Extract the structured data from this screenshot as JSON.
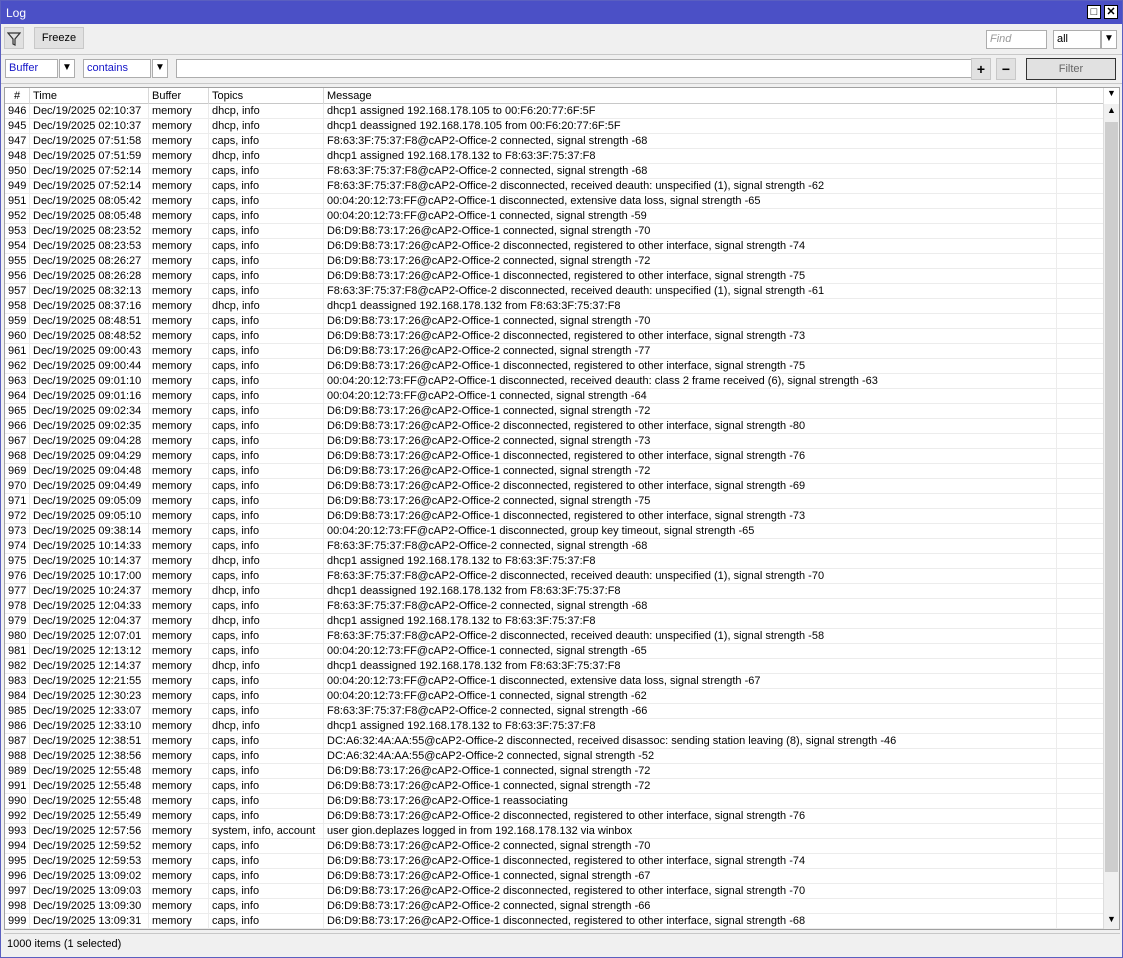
{
  "window": {
    "title": "Log",
    "maximize_icon": "maximize-icon",
    "close_icon": "close-icon"
  },
  "toolbar": {
    "filter_icon": "funnel-icon",
    "freeze_label": "Freeze",
    "find_placeholder": "Find",
    "find_scope": "all"
  },
  "filter": {
    "field": "Buffer",
    "operator": "contains",
    "value": "",
    "add_label": "+",
    "remove_label": "−",
    "filter_label": "Filter"
  },
  "table": {
    "columns": [
      "#",
      "Time",
      "Buffer",
      "Topics",
      "Message"
    ],
    "rows": [
      [
        "946",
        "Dec/19/2025 02:10:37",
        "memory",
        "dhcp, info",
        "dhcp1 assigned 192.168.178.105 to 00:F6:20:77:6F:5F"
      ],
      [
        "945",
        "Dec/19/2025 02:10:37",
        "memory",
        "dhcp, info",
        "dhcp1 deassigned 192.168.178.105 from 00:F6:20:77:6F:5F"
      ],
      [
        "947",
        "Dec/19/2025 07:51:58",
        "memory",
        "caps, info",
        "F8:63:3F:75:37:F8@cAP2-Office-2 connected, signal strength -68"
      ],
      [
        "948",
        "Dec/19/2025 07:51:59",
        "memory",
        "dhcp, info",
        "dhcp1 assigned 192.168.178.132 to F8:63:3F:75:37:F8"
      ],
      [
        "950",
        "Dec/19/2025 07:52:14",
        "memory",
        "caps, info",
        "F8:63:3F:75:37:F8@cAP2-Office-2 connected, signal strength -68"
      ],
      [
        "949",
        "Dec/19/2025 07:52:14",
        "memory",
        "caps, info",
        "F8:63:3F:75:37:F8@cAP2-Office-2 disconnected, received deauth: unspecified (1), signal strength -62"
      ],
      [
        "951",
        "Dec/19/2025 08:05:42",
        "memory",
        "caps, info",
        "00:04:20:12:73:FF@cAP2-Office-1 disconnected, extensive data loss, signal strength -65"
      ],
      [
        "952",
        "Dec/19/2025 08:05:48",
        "memory",
        "caps, info",
        "00:04:20:12:73:FF@cAP2-Office-1 connected, signal strength -59"
      ],
      [
        "953",
        "Dec/19/2025 08:23:52",
        "memory",
        "caps, info",
        "D6:D9:B8:73:17:26@cAP2-Office-1 connected, signal strength -70"
      ],
      [
        "954",
        "Dec/19/2025 08:23:53",
        "memory",
        "caps, info",
        "D6:D9:B8:73:17:26@cAP2-Office-2 disconnected, registered to other interface, signal strength -74"
      ],
      [
        "955",
        "Dec/19/2025 08:26:27",
        "memory",
        "caps, info",
        "D6:D9:B8:73:17:26@cAP2-Office-2 connected, signal strength -72"
      ],
      [
        "956",
        "Dec/19/2025 08:26:28",
        "memory",
        "caps, info",
        "D6:D9:B8:73:17:26@cAP2-Office-1 disconnected, registered to other interface, signal strength -75"
      ],
      [
        "957",
        "Dec/19/2025 08:32:13",
        "memory",
        "caps, info",
        "F8:63:3F:75:37:F8@cAP2-Office-2 disconnected, received deauth: unspecified (1), signal strength -61"
      ],
      [
        "958",
        "Dec/19/2025 08:37:16",
        "memory",
        "dhcp, info",
        "dhcp1 deassigned 192.168.178.132 from F8:63:3F:75:37:F8"
      ],
      [
        "959",
        "Dec/19/2025 08:48:51",
        "memory",
        "caps, info",
        "D6:D9:B8:73:17:26@cAP2-Office-1 connected, signal strength -70"
      ],
      [
        "960",
        "Dec/19/2025 08:48:52",
        "memory",
        "caps, info",
        "D6:D9:B8:73:17:26@cAP2-Office-2 disconnected, registered to other interface, signal strength -73"
      ],
      [
        "961",
        "Dec/19/2025 09:00:43",
        "memory",
        "caps, info",
        "D6:D9:B8:73:17:26@cAP2-Office-2 connected, signal strength -77"
      ],
      [
        "962",
        "Dec/19/2025 09:00:44",
        "memory",
        "caps, info",
        "D6:D9:B8:73:17:26@cAP2-Office-1 disconnected, registered to other interface, signal strength -75"
      ],
      [
        "963",
        "Dec/19/2025 09:01:10",
        "memory",
        "caps, info",
        "00:04:20:12:73:FF@cAP2-Office-1 disconnected, received deauth: class 2 frame received (6), signal strength -63"
      ],
      [
        "964",
        "Dec/19/2025 09:01:16",
        "memory",
        "caps, info",
        "00:04:20:12:73:FF@cAP2-Office-1 connected, signal strength -64"
      ],
      [
        "965",
        "Dec/19/2025 09:02:34",
        "memory",
        "caps, info",
        "D6:D9:B8:73:17:26@cAP2-Office-1 connected, signal strength -72"
      ],
      [
        "966",
        "Dec/19/2025 09:02:35",
        "memory",
        "caps, info",
        "D6:D9:B8:73:17:26@cAP2-Office-2 disconnected, registered to other interface, signal strength -80"
      ],
      [
        "967",
        "Dec/19/2025 09:04:28",
        "memory",
        "caps, info",
        "D6:D9:B8:73:17:26@cAP2-Office-2 connected, signal strength -73"
      ],
      [
        "968",
        "Dec/19/2025 09:04:29",
        "memory",
        "caps, info",
        "D6:D9:B8:73:17:26@cAP2-Office-1 disconnected, registered to other interface, signal strength -76"
      ],
      [
        "969",
        "Dec/19/2025 09:04:48",
        "memory",
        "caps, info",
        "D6:D9:B8:73:17:26@cAP2-Office-1 connected, signal strength -72"
      ],
      [
        "970",
        "Dec/19/2025 09:04:49",
        "memory",
        "caps, info",
        "D6:D9:B8:73:17:26@cAP2-Office-2 disconnected, registered to other interface, signal strength -69"
      ],
      [
        "971",
        "Dec/19/2025 09:05:09",
        "memory",
        "caps, info",
        "D6:D9:B8:73:17:26@cAP2-Office-2 connected, signal strength -75"
      ],
      [
        "972",
        "Dec/19/2025 09:05:10",
        "memory",
        "caps, info",
        "D6:D9:B8:73:17:26@cAP2-Office-1 disconnected, registered to other interface, signal strength -73"
      ],
      [
        "973",
        "Dec/19/2025 09:38:14",
        "memory",
        "caps, info",
        "00:04:20:12:73:FF@cAP2-Office-1 disconnected, group key timeout, signal strength -65"
      ],
      [
        "974",
        "Dec/19/2025 10:14:33",
        "memory",
        "caps, info",
        "F8:63:3F:75:37:F8@cAP2-Office-2 connected, signal strength -68"
      ],
      [
        "975",
        "Dec/19/2025 10:14:37",
        "memory",
        "dhcp, info",
        "dhcp1 assigned 192.168.178.132 to F8:63:3F:75:37:F8"
      ],
      [
        "976",
        "Dec/19/2025 10:17:00",
        "memory",
        "caps, info",
        "F8:63:3F:75:37:F8@cAP2-Office-2 disconnected, received deauth: unspecified (1), signal strength -70"
      ],
      [
        "977",
        "Dec/19/2025 10:24:37",
        "memory",
        "dhcp, info",
        "dhcp1 deassigned 192.168.178.132 from F8:63:3F:75:37:F8"
      ],
      [
        "978",
        "Dec/19/2025 12:04:33",
        "memory",
        "caps, info",
        "F8:63:3F:75:37:F8@cAP2-Office-2 connected, signal strength -68"
      ],
      [
        "979",
        "Dec/19/2025 12:04:37",
        "memory",
        "dhcp, info",
        "dhcp1 assigned 192.168.178.132 to F8:63:3F:75:37:F8"
      ],
      [
        "980",
        "Dec/19/2025 12:07:01",
        "memory",
        "caps, info",
        "F8:63:3F:75:37:F8@cAP2-Office-2 disconnected, received deauth: unspecified (1), signal strength -58"
      ],
      [
        "981",
        "Dec/19/2025 12:13:12",
        "memory",
        "caps, info",
        "00:04:20:12:73:FF@cAP2-Office-1 connected, signal strength -65"
      ],
      [
        "982",
        "Dec/19/2025 12:14:37",
        "memory",
        "dhcp, info",
        "dhcp1 deassigned 192.168.178.132 from F8:63:3F:75:37:F8"
      ],
      [
        "983",
        "Dec/19/2025 12:21:55",
        "memory",
        "caps, info",
        "00:04:20:12:73:FF@cAP2-Office-1 disconnected, extensive data loss, signal strength -67"
      ],
      [
        "984",
        "Dec/19/2025 12:30:23",
        "memory",
        "caps, info",
        "00:04:20:12:73:FF@cAP2-Office-1 connected, signal strength -62"
      ],
      [
        "985",
        "Dec/19/2025 12:33:07",
        "memory",
        "caps, info",
        "F8:63:3F:75:37:F8@cAP2-Office-2 connected, signal strength -66"
      ],
      [
        "986",
        "Dec/19/2025 12:33:10",
        "memory",
        "dhcp, info",
        "dhcp1 assigned 192.168.178.132 to F8:63:3F:75:37:F8"
      ],
      [
        "987",
        "Dec/19/2025 12:38:51",
        "memory",
        "caps, info",
        "DC:A6:32:4A:AA:55@cAP2-Office-2 disconnected, received disassoc: sending station leaving (8), signal strength -46"
      ],
      [
        "988",
        "Dec/19/2025 12:38:56",
        "memory",
        "caps, info",
        "DC:A6:32:4A:AA:55@cAP2-Office-2 connected, signal strength -52"
      ],
      [
        "989",
        "Dec/19/2025 12:55:48",
        "memory",
        "caps, info",
        "D6:D9:B8:73:17:26@cAP2-Office-1 connected, signal strength -72"
      ],
      [
        "991",
        "Dec/19/2025 12:55:48",
        "memory",
        "caps, info",
        "D6:D9:B8:73:17:26@cAP2-Office-1 connected, signal strength -72"
      ],
      [
        "990",
        "Dec/19/2025 12:55:48",
        "memory",
        "caps, info",
        "D6:D9:B8:73:17:26@cAP2-Office-1 reassociating"
      ],
      [
        "992",
        "Dec/19/2025 12:55:49",
        "memory",
        "caps, info",
        "D6:D9:B8:73:17:26@cAP2-Office-2 disconnected, registered to other interface, signal strength -76"
      ],
      [
        "993",
        "Dec/19/2025 12:57:56",
        "memory",
        "system, info, account",
        "user gion.deplazes logged in from 192.168.178.132 via winbox"
      ],
      [
        "994",
        "Dec/19/2025 12:59:52",
        "memory",
        "caps, info",
        "D6:D9:B8:73:17:26@cAP2-Office-2 connected, signal strength -70"
      ],
      [
        "995",
        "Dec/19/2025 12:59:53",
        "memory",
        "caps, info",
        "D6:D9:B8:73:17:26@cAP2-Office-1 disconnected, registered to other interface, signal strength -74"
      ],
      [
        "996",
        "Dec/19/2025 13:09:02",
        "memory",
        "caps, info",
        "D6:D9:B8:73:17:26@cAP2-Office-1 connected, signal strength -67"
      ],
      [
        "997",
        "Dec/19/2025 13:09:03",
        "memory",
        "caps, info",
        "D6:D9:B8:73:17:26@cAP2-Office-2 disconnected, registered to other interface, signal strength -70"
      ],
      [
        "998",
        "Dec/19/2025 13:09:30",
        "memory",
        "caps, info",
        "D6:D9:B8:73:17:26@cAP2-Office-2 connected, signal strength -66"
      ],
      [
        "999",
        "Dec/19/2025 13:09:31",
        "memory",
        "caps, info",
        "D6:D9:B8:73:17:26@cAP2-Office-1 disconnected, registered to other interface, signal strength -68"
      ]
    ]
  },
  "status": {
    "text": "1000 items (1 selected)"
  },
  "colors": {
    "titlebar": "#4b50c6",
    "filter_text": "#1515c8"
  }
}
